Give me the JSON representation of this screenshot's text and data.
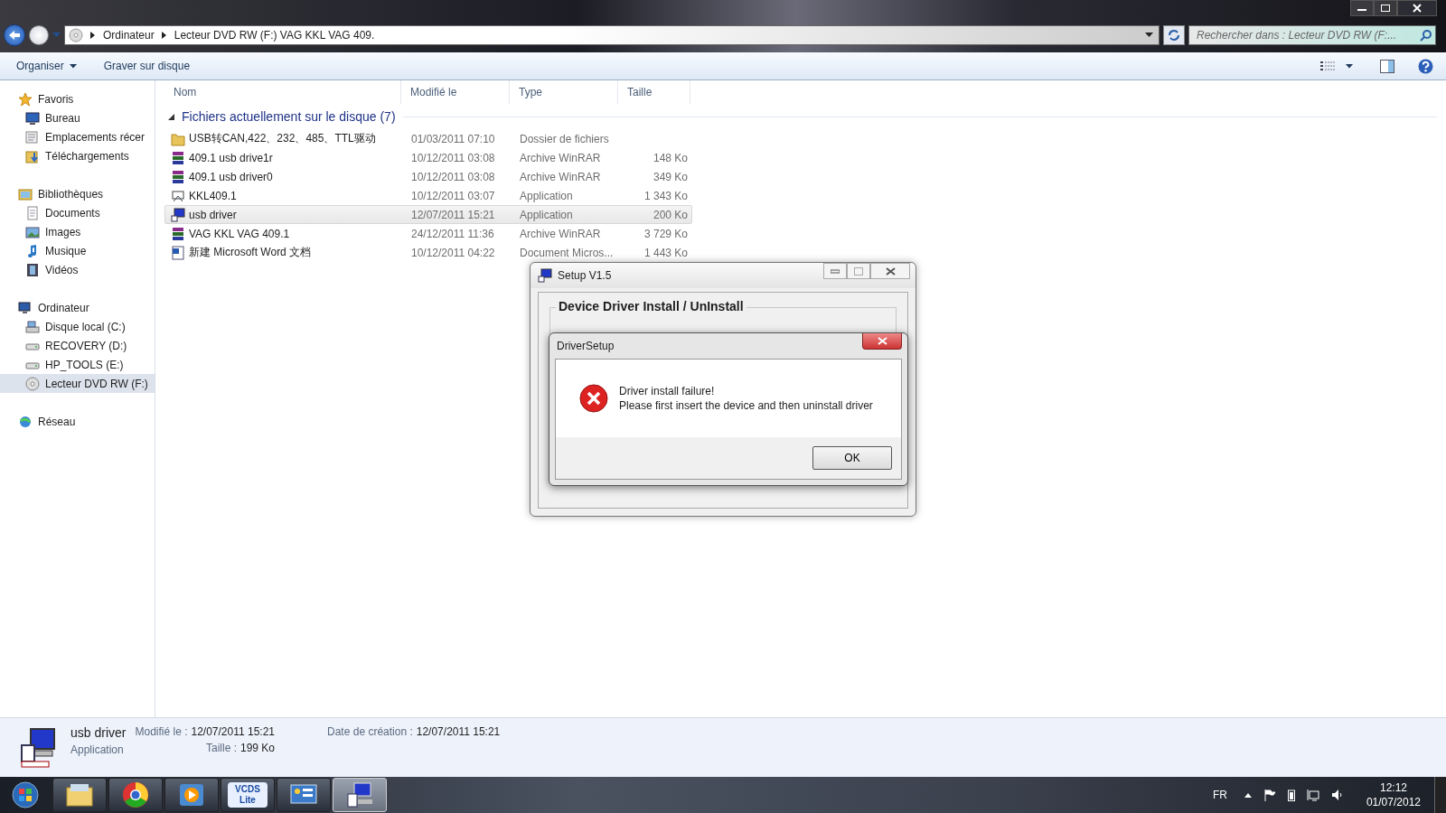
{
  "address_bar": {
    "path": [
      "Ordinateur",
      "Lecteur DVD RW (F:) VAG KKL VAG 409."
    ],
    "search_placeholder": "Rechercher dans : Lecteur DVD RW (F:..."
  },
  "toolbar": {
    "buttons": [
      {
        "label": "Organiser",
        "dropdown": true
      },
      {
        "label": "Graver sur disque",
        "dropdown": false
      }
    ]
  },
  "sidebar": {
    "groups": [
      {
        "label": "Favoris",
        "kind": "star",
        "selected": false,
        "children": [
          {
            "label": "Bureau",
            "kind": "desktop",
            "selected": false
          },
          {
            "label": "Emplacements récer",
            "kind": "recent",
            "selected": false
          },
          {
            "label": "Téléchargements",
            "kind": "download",
            "selected": false
          }
        ]
      },
      {
        "label": "Bibliothèques",
        "kind": "library",
        "selected": false,
        "children": [
          {
            "label": "Documents",
            "kind": "document",
            "selected": false
          },
          {
            "label": "Images",
            "kind": "image",
            "selected": false
          },
          {
            "label": "Musique",
            "kind": "music",
            "selected": false
          },
          {
            "label": "Vidéos",
            "kind": "video",
            "selected": false
          }
        ]
      },
      {
        "label": "Ordinateur",
        "kind": "computer",
        "selected": false,
        "children": [
          {
            "label": "Disque local (C:)",
            "kind": "disk",
            "selected": false
          },
          {
            "label": "RECOVERY (D:)",
            "kind": "drive",
            "selected": false
          },
          {
            "label": "HP_TOOLS (E:)",
            "kind": "drive",
            "selected": false
          },
          {
            "label": "Lecteur DVD RW (F:)",
            "kind": "dvd",
            "selected": true
          }
        ]
      },
      {
        "label": "Réseau",
        "kind": "network",
        "selected": false
      }
    ]
  },
  "table": {
    "columns": [
      "Nom",
      "Modifié le",
      "Type",
      "Taille"
    ],
    "group": "Fichiers actuellement sur le disque (7)",
    "rows": [
      {
        "name": "USB转CAN,422、232、485、TTL驱动",
        "modified": "01/03/2011 07:10",
        "type": "Dossier de fichiers",
        "kind": "folder",
        "selected": false
      },
      {
        "name": "409.1 usb drive1r",
        "modified": "10/12/2011 03:08",
        "type": "Archive WinRAR",
        "size": "148 Ko",
        "kind": "archive",
        "selected": false
      },
      {
        "name": "409.1 usb driver0",
        "modified": "10/12/2011 03:08",
        "type": "Archive WinRAR",
        "size": "349 Ko",
        "kind": "archive",
        "selected": false
      },
      {
        "name": "KKL409.1",
        "modified": "10/12/2011 03:07",
        "type": "Application",
        "size": "1 343 Ko",
        "kind": "app",
        "selected": false
      },
      {
        "name": "usb driver",
        "modified": "12/07/2011 15:21",
        "type": "Application",
        "size": "200 Ko",
        "kind": "usbapp",
        "selected": true
      },
      {
        "name": "VAG KKL VAG 409.1",
        "modified": "24/12/2011 11:36",
        "type": "Archive WinRAR",
        "size": "3 729 Ko",
        "kind": "archive",
        "selected": false
      },
      {
        "name": "新建 Microsoft Word 文档",
        "modified": "10/12/2011 04:22",
        "type": "Document Micros...",
        "size": "1 443 Ko",
        "kind": "word",
        "selected": false
      }
    ]
  },
  "setup_window": {
    "title": "Setup V1.5",
    "group_title": "Device Driver Install / UnInstall"
  },
  "message_dialog": {
    "title": "DriverSetup",
    "lines": [
      "Driver install failure!",
      "Please first insert the device and then uninstall driver"
    ],
    "button": "OK"
  },
  "details": {
    "name": "usb driver",
    "type": "Application",
    "fields": [
      {
        "label": "Modifié le :",
        "value": "12/07/2011 15:21"
      },
      {
        "label": "Taille :",
        "value": "199 Ko"
      },
      {
        "label": "Date de création :",
        "value": "12/07/2011 15:21"
      }
    ]
  },
  "taskbar": {
    "items": [
      {
        "kind": "explorer",
        "selected": false
      },
      {
        "kind": "chrome",
        "selected": false
      },
      {
        "kind": "media",
        "selected": false
      },
      {
        "kind": "vcds",
        "label": "VCDS Lite",
        "selected": false
      },
      {
        "kind": "panel",
        "selected": false
      },
      {
        "kind": "usbapp",
        "selected": true
      }
    ],
    "language": "FR",
    "time": "12:12",
    "date": "01/07/2012"
  }
}
